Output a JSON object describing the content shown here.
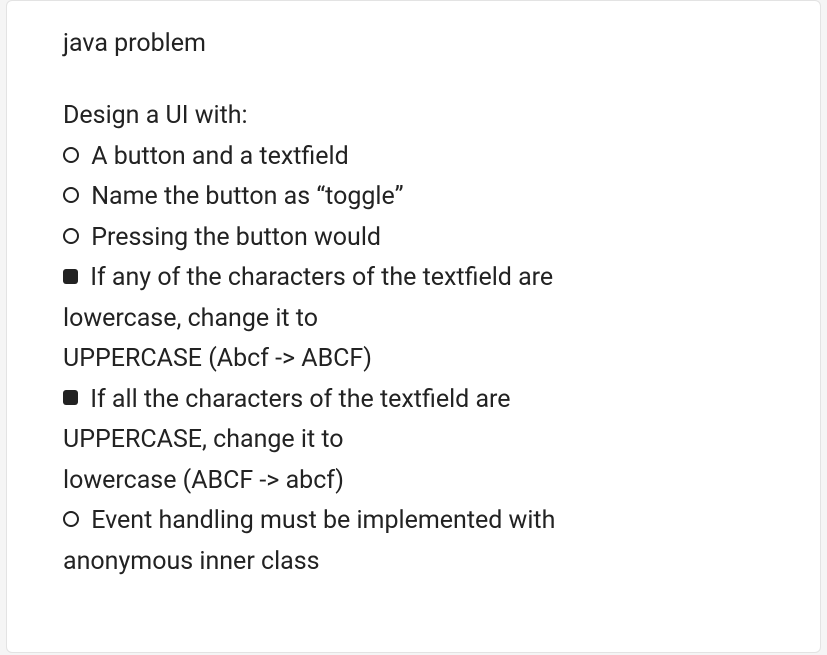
{
  "title": "java problem",
  "lines": [
    {
      "bullet": null,
      "text": "Design a UI with:"
    },
    {
      "bullet": "circle",
      "text": "A button and a textfield"
    },
    {
      "bullet": "circle",
      "text": "Name the button as “toggle”"
    },
    {
      "bullet": "circle",
      "text": "Pressing the button would"
    },
    {
      "bullet": "square",
      "text": "If any of the characters of the textfield are"
    },
    {
      "bullet": null,
      "text": "lowercase, change it to"
    },
    {
      "bullet": null,
      "text": "UPPERCASE (Abcf -> ABCF)"
    },
    {
      "bullet": "square",
      "text": "If all the characters of the textfield are"
    },
    {
      "bullet": null,
      "text": "UPPERCASE, change it to"
    },
    {
      "bullet": null,
      "text": "lowercase (ABCF -> abcf)"
    },
    {
      "bullet": "circle",
      "text": "Event handling must be implemented with"
    },
    {
      "bullet": null,
      "text": "anonymous inner class"
    }
  ]
}
